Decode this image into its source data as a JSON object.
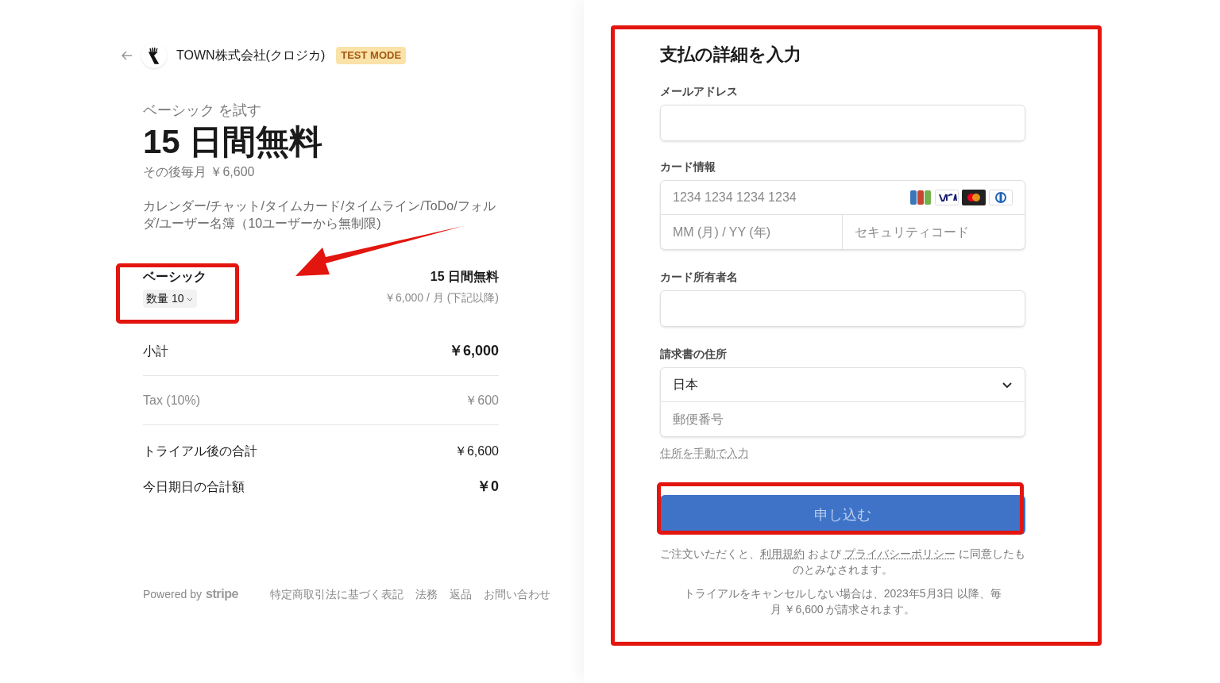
{
  "merchant": {
    "name": "TOWN株式会社(クロジカ)",
    "badge": "TEST MODE"
  },
  "summary": {
    "eyebrow": "ベーシック を試す",
    "headline": "15 日間無料",
    "subline": "その後毎月 ￥6,600",
    "description": "カレンダー/チャット/タイムカード/タイムライン/ToDo/フォルダ/ユーザー名簿（10ユーザーから無制限)"
  },
  "line_item": {
    "name": "ベーシック",
    "quantity": "数量 10",
    "price": "15 日間無料",
    "price_note": "￥6,000 / 月 (下記以降)"
  },
  "totals": [
    {
      "label": "小計",
      "amount": "￥6,000",
      "kind": "strong"
    },
    {
      "label": "Tax (10%)",
      "amount": "￥600",
      "kind": "muted"
    },
    {
      "label": "トライアル後の合計",
      "amount": "￥6,600",
      "kind": "normal"
    },
    {
      "label": "今日期日の合計額",
      "amount": "￥0",
      "kind": "strong"
    }
  ],
  "footer": {
    "powered_by": "Powered by",
    "brand": "stripe",
    "links": [
      "特定商取引法に基づく表記",
      "法務",
      "返品",
      "お問い合わせ"
    ]
  },
  "form": {
    "title": "支払の詳細を入力",
    "email": {
      "label": "メールアドレス"
    },
    "card": {
      "label": "カード情報",
      "number_placeholder": "1234 1234 1234 1234",
      "expiry_placeholder": "MM (月) / YY (年)",
      "cvc_placeholder": "セキュリティコード"
    },
    "holder": {
      "label": "カード所有者名"
    },
    "address": {
      "label": "請求書の住所",
      "country": "日本",
      "postal_placeholder": "郵便番号",
      "manual_link": "住所を手動で入力"
    },
    "submit": "申し込む",
    "terms": {
      "before": "ご注文いただくと、",
      "link1": "利用規約",
      "middle": " および ",
      "link2": "プライバシーポリシー",
      "after": " に同意したものとみなされます。"
    },
    "trial_notice": "トライアルをキャンセルしない場合は、2023年5月3日 以降、毎月 ￥6,600 が請求されます。"
  }
}
